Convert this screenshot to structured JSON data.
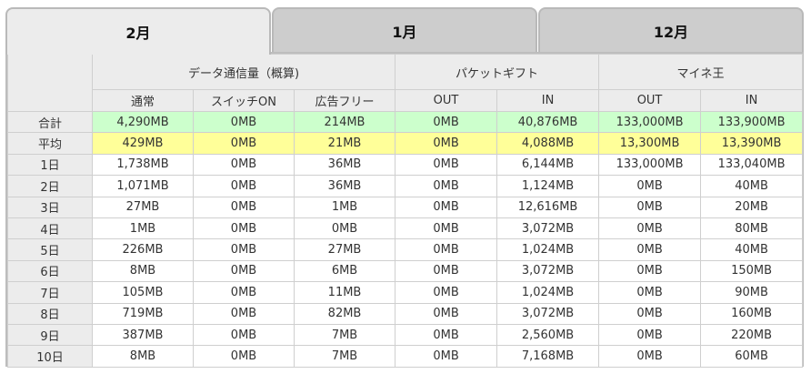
{
  "tabs": [
    {
      "label": "2月",
      "active": true
    },
    {
      "label": "1月",
      "active": false
    },
    {
      "label": "12月",
      "active": false
    }
  ],
  "groups": [
    {
      "label": "データ通信量（概算)"
    },
    {
      "label": "パケットギフト"
    },
    {
      "label": "マイネ王"
    }
  ],
  "subheaders": [
    "通常",
    "スイッチON",
    "広告フリー",
    "OUT",
    "IN",
    "OUT",
    "IN"
  ],
  "summary": {
    "total": {
      "label": "合計",
      "values": [
        "4,290MB",
        "0MB",
        "214MB",
        "0MB",
        "40,876MB",
        "133,000MB",
        "133,900MB"
      ]
    },
    "average": {
      "label": "平均",
      "values": [
        "429MB",
        "0MB",
        "21MB",
        "0MB",
        "4,088MB",
        "13,300MB",
        "13,390MB"
      ]
    }
  },
  "rows": [
    {
      "label": "1日",
      "values": [
        "1,738MB",
        "0MB",
        "36MB",
        "0MB",
        "6,144MB",
        "133,000MB",
        "133,040MB"
      ]
    },
    {
      "label": "2日",
      "values": [
        "1,071MB",
        "0MB",
        "36MB",
        "0MB",
        "1,124MB",
        "0MB",
        "40MB"
      ]
    },
    {
      "label": "3日",
      "values": [
        "27MB",
        "0MB",
        "1MB",
        "0MB",
        "12,616MB",
        "0MB",
        "20MB"
      ]
    },
    {
      "label": "4日",
      "values": [
        "1MB",
        "0MB",
        "0MB",
        "0MB",
        "3,072MB",
        "0MB",
        "80MB"
      ]
    },
    {
      "label": "5日",
      "values": [
        "226MB",
        "0MB",
        "27MB",
        "0MB",
        "1,024MB",
        "0MB",
        "40MB"
      ]
    },
    {
      "label": "6日",
      "values": [
        "8MB",
        "0MB",
        "6MB",
        "0MB",
        "3,072MB",
        "0MB",
        "150MB"
      ]
    },
    {
      "label": "7日",
      "values": [
        "105MB",
        "0MB",
        "11MB",
        "0MB",
        "1,024MB",
        "0MB",
        "90MB"
      ]
    },
    {
      "label": "8日",
      "values": [
        "719MB",
        "0MB",
        "82MB",
        "0MB",
        "3,072MB",
        "0MB",
        "160MB"
      ]
    },
    {
      "label": "9日",
      "values": [
        "387MB",
        "0MB",
        "7MB",
        "0MB",
        "2,560MB",
        "0MB",
        "220MB"
      ]
    },
    {
      "label": "10日",
      "values": [
        "8MB",
        "0MB",
        "7MB",
        "0MB",
        "7,168MB",
        "0MB",
        "60MB"
      ]
    }
  ],
  "colors": {
    "total_row": "#ccffcc",
    "average_row": "#ffff99",
    "tab_active": "#ececec",
    "tab_inactive": "#cdcdcd"
  }
}
